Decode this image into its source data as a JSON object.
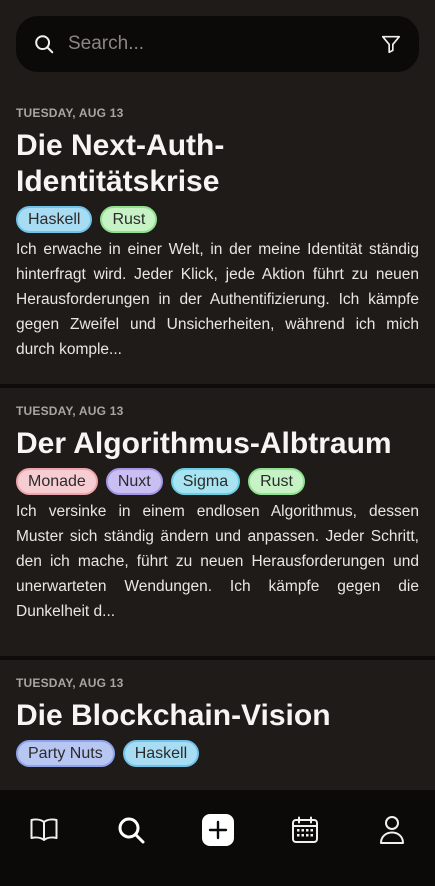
{
  "search": {
    "placeholder": "Search...",
    "value": ""
  },
  "entries": [
    {
      "date": "TUESDAY, AUG 13",
      "title": "Die Next-Auth-Identitätskrise",
      "tags": [
        {
          "label": "Haskell",
          "bg": "#a8dcf2",
          "border": "#6fc3ea"
        },
        {
          "label": "Rust",
          "bg": "#c6f2c6",
          "border": "#8fe08f"
        }
      ],
      "text": "Ich erwache in einer Welt, in der meine Identität ständig hinterfragt wird. Jeder Klick, jede Aktion führt zu neuen Herausforderungen in der Authentifizierung. Ich kämpfe gegen Zweifel und Unsicherheiten, während ich mich durch komple..."
    },
    {
      "date": "TUESDAY, AUG 13",
      "title": "Der Algorithmus-Albtraum",
      "tags": [
        {
          "label": "Monade",
          "bg": "#f6cdd2",
          "border": "#eea5ae"
        },
        {
          "label": "Nuxt",
          "bg": "#c9bff2",
          "border": "#a597e6"
        },
        {
          "label": "Sigma",
          "bg": "#a7e3f0",
          "border": "#6bcfe3"
        },
        {
          "label": "Rust",
          "bg": "#c6f2c6",
          "border": "#8fe08f"
        }
      ],
      "text": "Ich versinke in einem endlosen Algorithmus, dessen Muster sich ständig ändern und anpassen. Jeder Schritt, den ich mache, führt zu neuen Herausforderungen und unerwarteten Wendungen. Ich kämpfe gegen die Dunkelheit d..."
    },
    {
      "date": "TUESDAY, AUG 13",
      "title": "Die Blockchain-Vision",
      "tags": [
        {
          "label": "Party Nuts",
          "bg": "#b8c6f2",
          "border": "#8ea3ea"
        },
        {
          "label": "Haskell",
          "bg": "#a8dcf2",
          "border": "#6fc3ea"
        }
      ],
      "text": ""
    }
  ],
  "tabbar": {
    "items": [
      {
        "icon": "book-icon"
      },
      {
        "icon": "search-icon"
      },
      {
        "icon": "plus-icon"
      },
      {
        "icon": "calendar-icon"
      },
      {
        "icon": "user-icon"
      }
    ]
  },
  "colors": {
    "background": "#1e1b19",
    "search_bar": "#0b0a09",
    "tabbar": "#0b0a09",
    "text": "#f2f0ee",
    "muted": "#a9a5a1"
  }
}
